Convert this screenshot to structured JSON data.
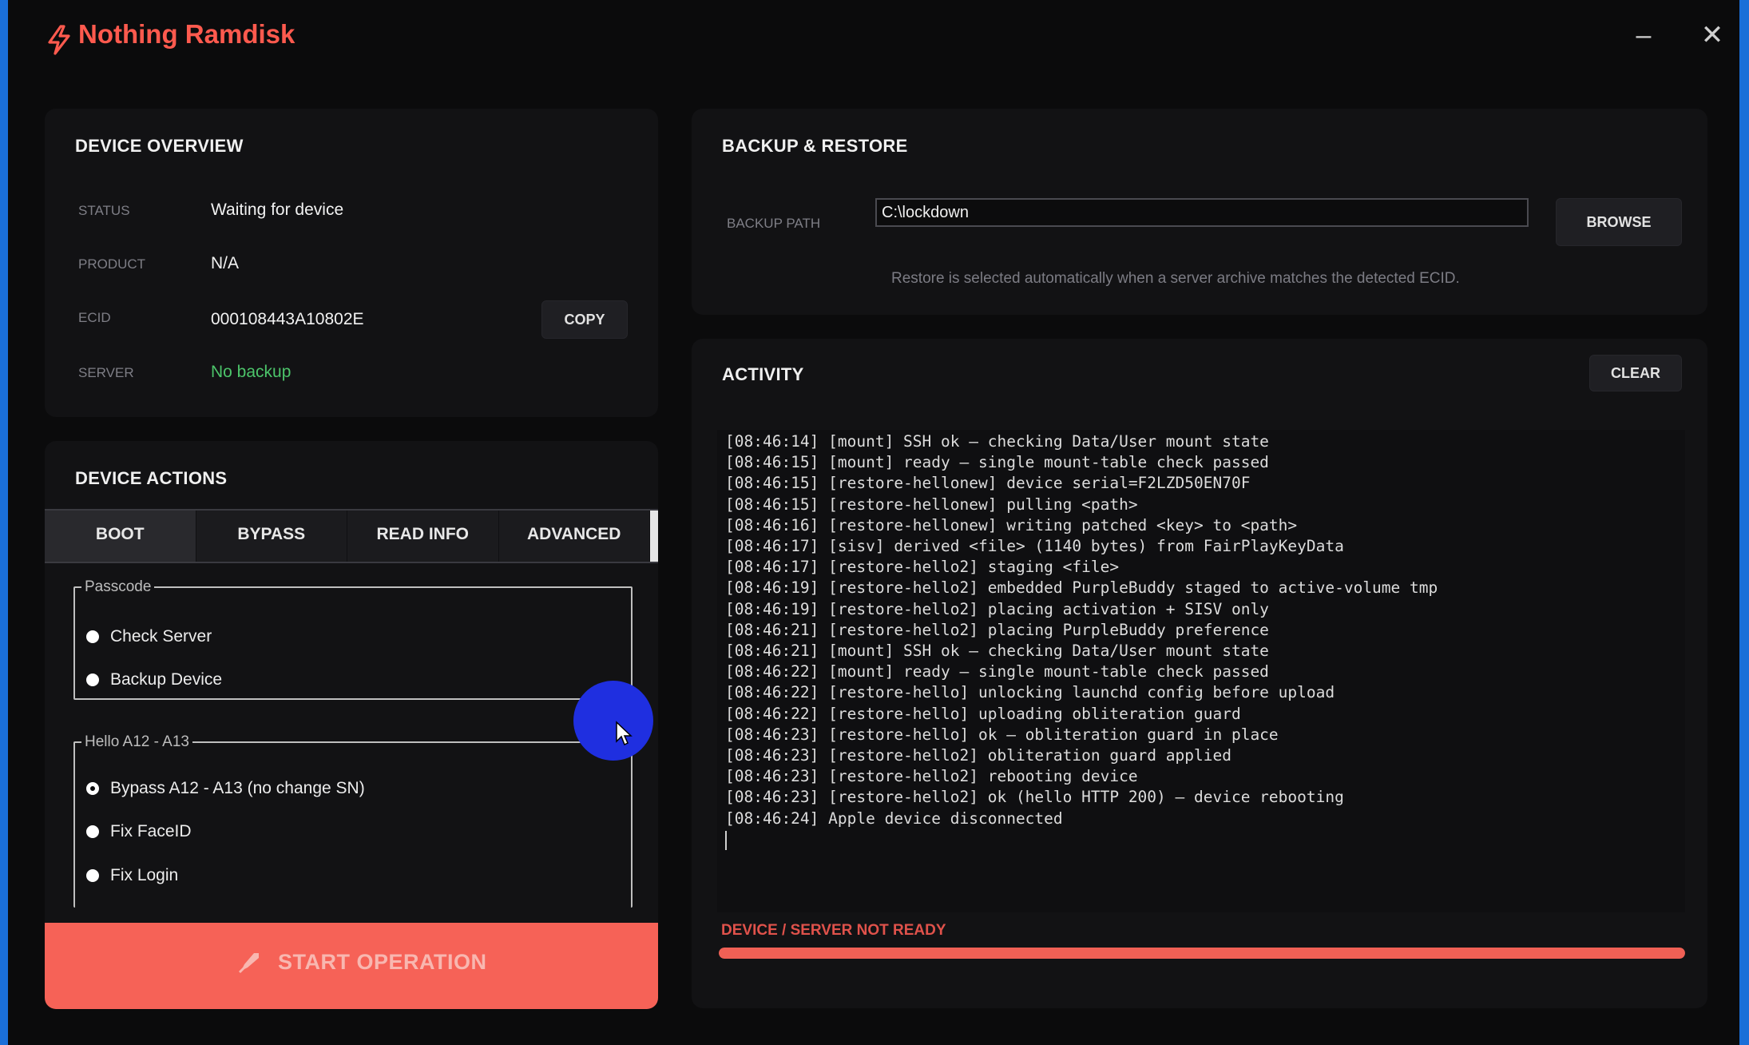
{
  "app": {
    "title": "Nothing Ramdisk",
    "accent_color": "#ff5a4e",
    "icon": "lightning-bolt-icon"
  },
  "window_controls": {
    "minimize_label": "–",
    "close_label": "✕"
  },
  "device_overview": {
    "title": "DEVICE OVERVIEW",
    "status_label": "STATUS",
    "status_value": "Waiting for device",
    "product_label": "PRODUCT",
    "product_value": "N/A",
    "ecid_label": "ECID",
    "ecid_value": "000108443A10802E",
    "copy_label": "COPY",
    "server_label": "SERVER",
    "server_value": "No backup",
    "server_value_color": "#4cc46a"
  },
  "device_actions": {
    "title": "DEVICE ACTIONS",
    "tabs": [
      {
        "label": "BOOT",
        "active": true
      },
      {
        "label": "BYPASS",
        "active": false
      },
      {
        "label": "READ INFO",
        "active": false
      },
      {
        "label": "ADVANCED",
        "active": false
      }
    ],
    "passcode_group": {
      "legend": "Passcode",
      "options": [
        "Check Server",
        "Backup Device"
      ]
    },
    "hello_group": {
      "legend": "Hello A12 - A13",
      "options": [
        "Bypass A12 - A13 (no change SN)",
        "Fix FaceID",
        "Fix Login"
      ]
    },
    "start_label": "START OPERATION",
    "start_color": "#f66257"
  },
  "backup_restore": {
    "title": "BACKUP & RESTORE",
    "path_label": "BACKUP PATH",
    "path_value": "C:\\lockdown",
    "browse_label": "BROWSE",
    "hint": "Restore is selected automatically when a server archive matches the detected ECID."
  },
  "activity": {
    "title": "ACTIVITY",
    "clear_label": "CLEAR",
    "log": [
      "[08:46:14] [mount] SSH ok — checking Data/User mount state",
      "[08:46:15] [mount] ready — single mount-table check passed",
      "[08:46:15] [restore-hellonew] device serial=F2LZD50EN70F",
      "[08:46:15] [restore-hellonew] pulling <path>",
      "[08:46:16] [restore-hellonew] writing patched <key> to <path>",
      "[08:46:17] [sisv] derived <file> (1140 bytes) from FairPlayKeyData",
      "[08:46:17] [restore-hello2] staging <file>",
      "[08:46:19] [restore-hello2] embedded PurpleBuddy staged to active-volume tmp",
      "[08:46:19] [restore-hello2] placing activation + SISV only",
      "[08:46:21] [restore-hello2] placing PurpleBuddy preference",
      "[08:46:21] [mount] SSH ok — checking Data/User mount state",
      "[08:46:22] [mount] ready — single mount-table check passed",
      "[08:46:22] [restore-hello] unlocking launchd config before upload",
      "[08:46:22] [restore-hello] uploading obliteration guard",
      "[08:46:23] [restore-hello] ok — obliteration guard in place",
      "[08:46:23] [restore-hello2] obliteration guard applied",
      "[08:46:23] [restore-hello2] rebooting device",
      "[08:46:23] [restore-hello2] ok (hello HTTP 200) — device rebooting",
      "[08:46:24] Apple device disconnected"
    ],
    "status_text": "DEVICE / SERVER NOT READY",
    "status_color": "#e0524b",
    "progress": 1.0
  }
}
